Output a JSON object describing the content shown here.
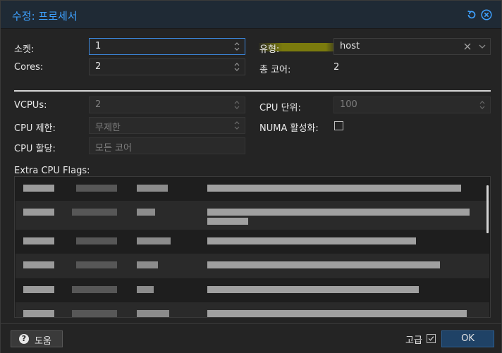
{
  "dialog": {
    "title": "수정: 프로세서",
    "reset_icon": "undo-icon",
    "close_icon": "close-circle-icon"
  },
  "general": {
    "sockets_label": "소켓:",
    "sockets_value": "1",
    "cores_label": "Cores:",
    "cores_value": "2",
    "type_label": "유형:",
    "type_value": "host",
    "total_cores_label": "총 코어:",
    "total_cores_value": "2"
  },
  "advanced": {
    "vcpus_label": "VCPUs:",
    "vcpus_value": "2",
    "cpu_limit_label": "CPU 제한:",
    "cpu_limit_value": "무제한",
    "cpu_affinity_label": "CPU 할당:",
    "cpu_affinity_placeholder": "모든 코어",
    "cpu_units_label": "CPU 단위:",
    "cpu_units_value": "100",
    "numa_label": "NUMA 활성화:",
    "numa_checked": false
  },
  "flags": {
    "label": "Extra CPU Flags:",
    "row_count_visible": 6
  },
  "footer": {
    "help_label": "도움",
    "advanced_label": "고급",
    "advanced_checked": true,
    "ok_label": "OK"
  },
  "colors": {
    "accent": "#3ea1ff",
    "ok_button": "#1f4266",
    "highlight": "#aaaa00"
  }
}
